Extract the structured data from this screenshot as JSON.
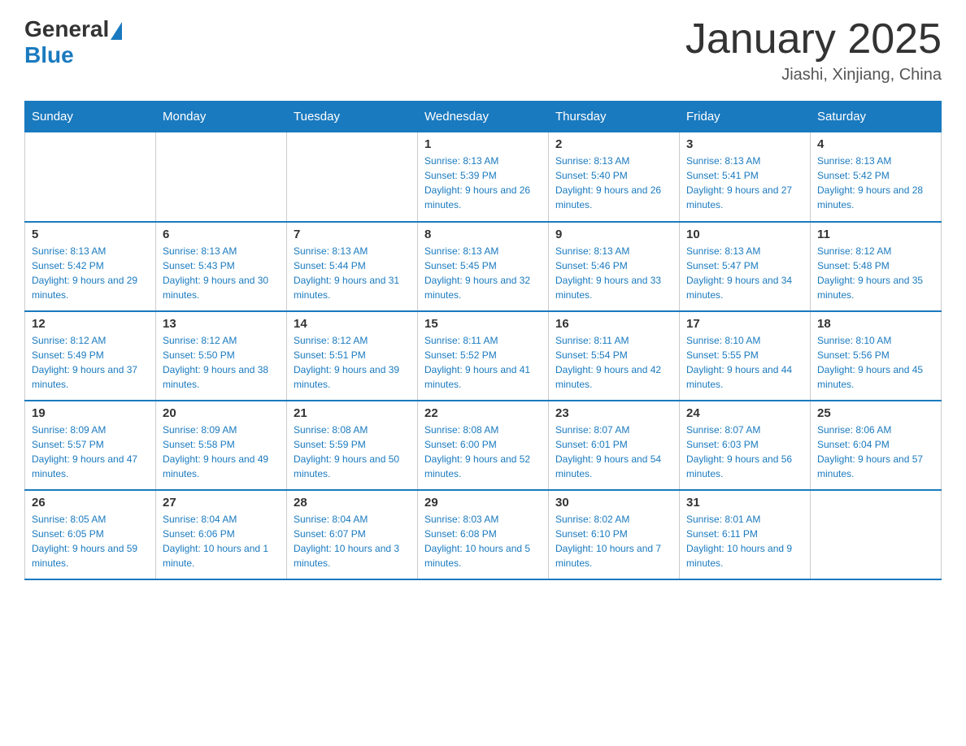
{
  "header": {
    "logo_general": "General",
    "logo_blue": "Blue",
    "month_title": "January 2025",
    "location": "Jiashi, Xinjiang, China"
  },
  "days_of_week": [
    "Sunday",
    "Monday",
    "Tuesday",
    "Wednesday",
    "Thursday",
    "Friday",
    "Saturday"
  ],
  "weeks": [
    [
      {
        "day": "",
        "info": ""
      },
      {
        "day": "",
        "info": ""
      },
      {
        "day": "",
        "info": ""
      },
      {
        "day": "1",
        "info": "Sunrise: 8:13 AM\nSunset: 5:39 PM\nDaylight: 9 hours and 26 minutes."
      },
      {
        "day": "2",
        "info": "Sunrise: 8:13 AM\nSunset: 5:40 PM\nDaylight: 9 hours and 26 minutes."
      },
      {
        "day": "3",
        "info": "Sunrise: 8:13 AM\nSunset: 5:41 PM\nDaylight: 9 hours and 27 minutes."
      },
      {
        "day": "4",
        "info": "Sunrise: 8:13 AM\nSunset: 5:42 PM\nDaylight: 9 hours and 28 minutes."
      }
    ],
    [
      {
        "day": "5",
        "info": "Sunrise: 8:13 AM\nSunset: 5:42 PM\nDaylight: 9 hours and 29 minutes."
      },
      {
        "day": "6",
        "info": "Sunrise: 8:13 AM\nSunset: 5:43 PM\nDaylight: 9 hours and 30 minutes."
      },
      {
        "day": "7",
        "info": "Sunrise: 8:13 AM\nSunset: 5:44 PM\nDaylight: 9 hours and 31 minutes."
      },
      {
        "day": "8",
        "info": "Sunrise: 8:13 AM\nSunset: 5:45 PM\nDaylight: 9 hours and 32 minutes."
      },
      {
        "day": "9",
        "info": "Sunrise: 8:13 AM\nSunset: 5:46 PM\nDaylight: 9 hours and 33 minutes."
      },
      {
        "day": "10",
        "info": "Sunrise: 8:13 AM\nSunset: 5:47 PM\nDaylight: 9 hours and 34 minutes."
      },
      {
        "day": "11",
        "info": "Sunrise: 8:12 AM\nSunset: 5:48 PM\nDaylight: 9 hours and 35 minutes."
      }
    ],
    [
      {
        "day": "12",
        "info": "Sunrise: 8:12 AM\nSunset: 5:49 PM\nDaylight: 9 hours and 37 minutes."
      },
      {
        "day": "13",
        "info": "Sunrise: 8:12 AM\nSunset: 5:50 PM\nDaylight: 9 hours and 38 minutes."
      },
      {
        "day": "14",
        "info": "Sunrise: 8:12 AM\nSunset: 5:51 PM\nDaylight: 9 hours and 39 minutes."
      },
      {
        "day": "15",
        "info": "Sunrise: 8:11 AM\nSunset: 5:52 PM\nDaylight: 9 hours and 41 minutes."
      },
      {
        "day": "16",
        "info": "Sunrise: 8:11 AM\nSunset: 5:54 PM\nDaylight: 9 hours and 42 minutes."
      },
      {
        "day": "17",
        "info": "Sunrise: 8:10 AM\nSunset: 5:55 PM\nDaylight: 9 hours and 44 minutes."
      },
      {
        "day": "18",
        "info": "Sunrise: 8:10 AM\nSunset: 5:56 PM\nDaylight: 9 hours and 45 minutes."
      }
    ],
    [
      {
        "day": "19",
        "info": "Sunrise: 8:09 AM\nSunset: 5:57 PM\nDaylight: 9 hours and 47 minutes."
      },
      {
        "day": "20",
        "info": "Sunrise: 8:09 AM\nSunset: 5:58 PM\nDaylight: 9 hours and 49 minutes."
      },
      {
        "day": "21",
        "info": "Sunrise: 8:08 AM\nSunset: 5:59 PM\nDaylight: 9 hours and 50 minutes."
      },
      {
        "day": "22",
        "info": "Sunrise: 8:08 AM\nSunset: 6:00 PM\nDaylight: 9 hours and 52 minutes."
      },
      {
        "day": "23",
        "info": "Sunrise: 8:07 AM\nSunset: 6:01 PM\nDaylight: 9 hours and 54 minutes."
      },
      {
        "day": "24",
        "info": "Sunrise: 8:07 AM\nSunset: 6:03 PM\nDaylight: 9 hours and 56 minutes."
      },
      {
        "day": "25",
        "info": "Sunrise: 8:06 AM\nSunset: 6:04 PM\nDaylight: 9 hours and 57 minutes."
      }
    ],
    [
      {
        "day": "26",
        "info": "Sunrise: 8:05 AM\nSunset: 6:05 PM\nDaylight: 9 hours and 59 minutes."
      },
      {
        "day": "27",
        "info": "Sunrise: 8:04 AM\nSunset: 6:06 PM\nDaylight: 10 hours and 1 minute."
      },
      {
        "day": "28",
        "info": "Sunrise: 8:04 AM\nSunset: 6:07 PM\nDaylight: 10 hours and 3 minutes."
      },
      {
        "day": "29",
        "info": "Sunrise: 8:03 AM\nSunset: 6:08 PM\nDaylight: 10 hours and 5 minutes."
      },
      {
        "day": "30",
        "info": "Sunrise: 8:02 AM\nSunset: 6:10 PM\nDaylight: 10 hours and 7 minutes."
      },
      {
        "day": "31",
        "info": "Sunrise: 8:01 AM\nSunset: 6:11 PM\nDaylight: 10 hours and 9 minutes."
      },
      {
        "day": "",
        "info": ""
      }
    ]
  ]
}
